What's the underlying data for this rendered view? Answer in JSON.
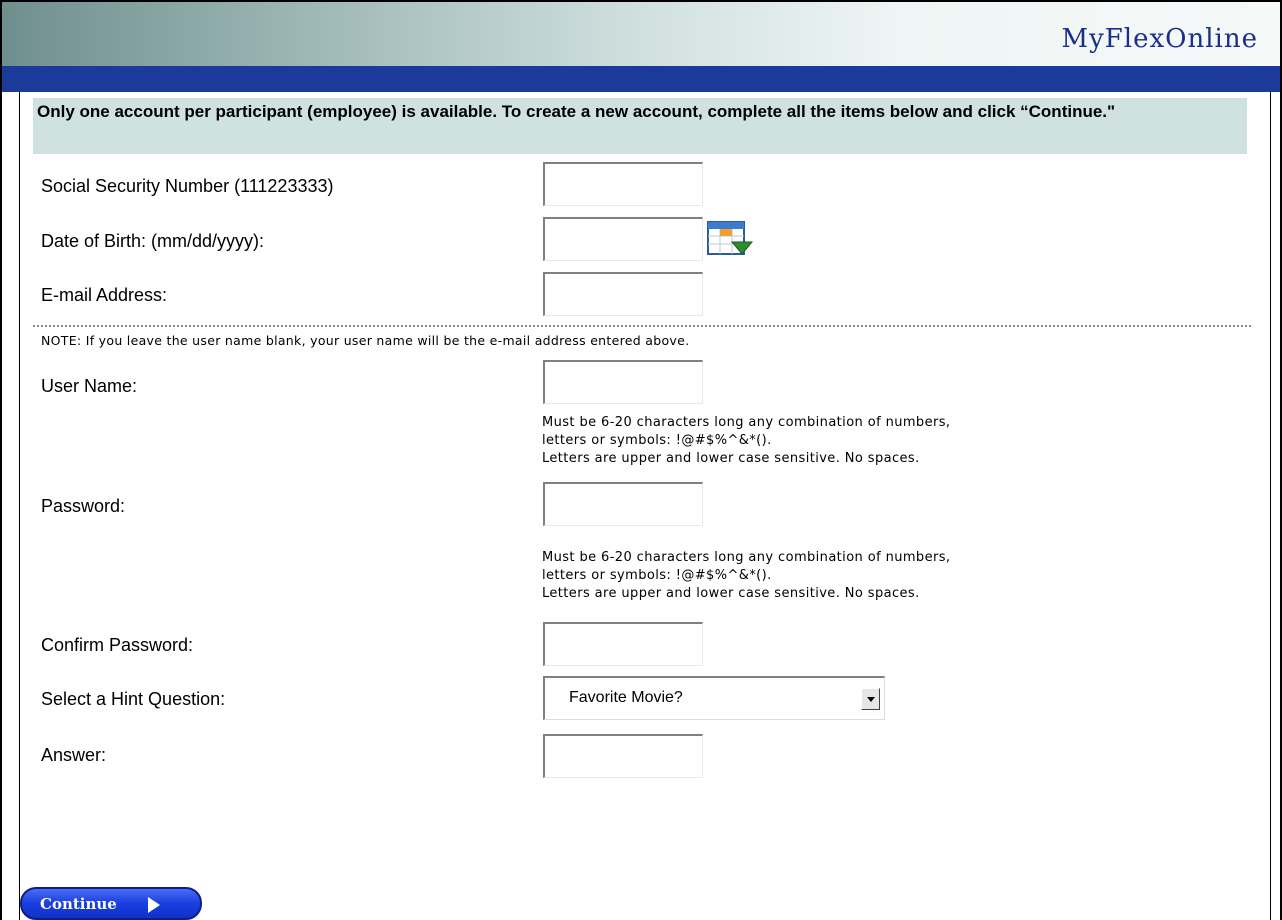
{
  "header": {
    "brand": "MyFlexOnline"
  },
  "intro": "Only one account per participant (employee) is available. To create a new account, complete all the items below and click “Continue.\"",
  "fields": {
    "ssn": {
      "label": "Social Security Number (111223333)",
      "value": ""
    },
    "dob": {
      "label": "Date of Birth: (mm/dd/yyyy):",
      "value": ""
    },
    "email": {
      "label": "E-mail Address:",
      "value": ""
    },
    "username": {
      "label": "User Name:",
      "value": ""
    },
    "password": {
      "label": "Password:",
      "value": ""
    },
    "confirm": {
      "label": "Confirm Password:",
      "value": ""
    },
    "hint": {
      "label": "Select a Hint Question:",
      "selected": "Favorite Movie?"
    },
    "answer": {
      "label": "Answer:",
      "value": ""
    }
  },
  "note": "NOTE: If you leave the user name blank, your user name will be the e-mail address entered above.",
  "username_rules": [
    "Must be 6-20 characters long any combination of numbers,",
    "letters or symbols:  !@#$%^&*().",
    "Letters are upper and lower case sensitive.  No spaces."
  ],
  "password_rules": [
    "Must be 6-20 characters long any combination of numbers,",
    "letters or symbols:  !@#$%^&*().",
    "Letters are upper and lower case sensitive.  No spaces."
  ],
  "continue_label": "Continue",
  "icons": {
    "calendar": "calendar-icon",
    "continue_arrow": "play-arrow-icon",
    "dropdown": "chevron-down-icon"
  },
  "colors": {
    "brand_blue": "#1b3a9a",
    "intro_bg": "#cfe2df",
    "button_blue": "#1a3fe0"
  }
}
